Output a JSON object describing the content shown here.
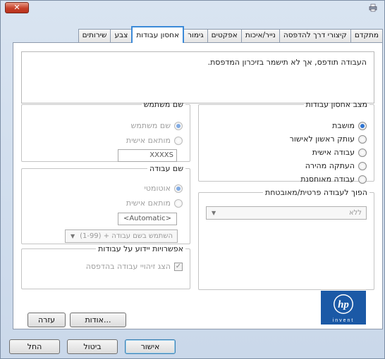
{
  "window": {
    "close_label": "✕"
  },
  "tabs": [
    {
      "label": "מתקדם"
    },
    {
      "label": "קיצורי דרך להדפסה"
    },
    {
      "label": "נייר/איכות"
    },
    {
      "label": "אפקטים"
    },
    {
      "label": "גימור"
    },
    {
      "label": "אחסון עבודות"
    },
    {
      "label": "צבע"
    },
    {
      "label": "שירותים"
    }
  ],
  "active_tab_index": 5,
  "description": "העבודה תודפס, אך לא תישמר בזיכרון המדפסת.",
  "job_storage_mode": {
    "legend": "מצב אחסון עבודות",
    "options": [
      {
        "label": "מושבת",
        "selected": true,
        "enabled": true
      },
      {
        "label": "עותק ראשון לאישור",
        "selected": false,
        "enabled": true
      },
      {
        "label": "עבודה אישית",
        "selected": false,
        "enabled": true
      },
      {
        "label": "העתקה מהירה",
        "selected": false,
        "enabled": true
      },
      {
        "label": "עבודה מאוחסנת",
        "selected": false,
        "enabled": true
      }
    ]
  },
  "user_name": {
    "legend": "שם משתמש",
    "options": [
      {
        "label": "שם משתמש",
        "selected": true
      },
      {
        "label": "מותאם אישית",
        "selected": false
      }
    ],
    "value": "XXXXS"
  },
  "job_name": {
    "legend": "שם עבודה",
    "options": [
      {
        "label": "אוטומטי",
        "selected": true
      },
      {
        "label": "מותאם אישית",
        "selected": false
      }
    ],
    "value": "<Automatic>",
    "duplicate_option": "השתמש בשם עבודה + (1-99)"
  },
  "private_job": {
    "legend": "הפוך לעבודה פרטית/מאובטחת",
    "value": "ללא"
  },
  "notification": {
    "legend": "אפשרויות יידוע על עבודות",
    "checkbox_label": "הצג זיהויי עבודה בהדפסה",
    "checked": true
  },
  "buttons": {
    "about": "אודות...",
    "help": "עזרה",
    "ok": "אישור",
    "cancel": "ביטול",
    "apply": "החל"
  },
  "logo": {
    "brand": "hp",
    "tagline": "invent"
  }
}
